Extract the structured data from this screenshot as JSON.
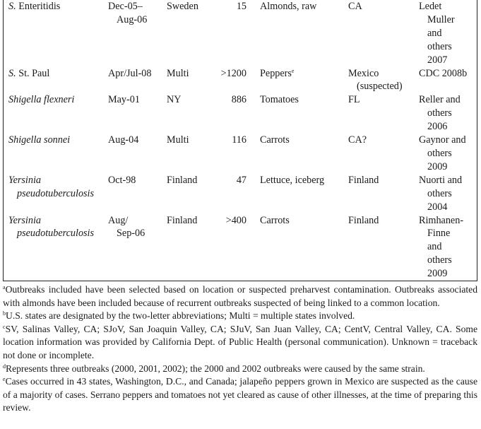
{
  "table": {
    "rows": [
      {
        "species_italic": "S.",
        "species_roman": " Enteritidis",
        "dates": "Dec-05–\nAug-06",
        "country": "Sweden",
        "cases": "15",
        "vehicle": "Almonds, raw",
        "vehicle_sup": "",
        "origin": "CA",
        "reference": "Ledet\nMuller\nand\nothers\n2007"
      },
      {
        "species_italic": "S.",
        "species_roman": " St. Paul",
        "dates": "Apr/Jul-08",
        "country": "Multi",
        "cases": ">1200",
        "vehicle": "Peppers",
        "vehicle_sup": "e",
        "origin": "Mexico\n(suspected)",
        "reference": "CDC 2008b"
      },
      {
        "species_italic": "Shigella flexneri",
        "species_roman": "",
        "dates": "May-01",
        "country": "NY",
        "cases": "886",
        "vehicle": "Tomatoes",
        "vehicle_sup": "",
        "origin": "FL",
        "reference": "Reller and\nothers\n2006"
      },
      {
        "species_italic": "Shigella sonnei",
        "species_roman": "",
        "dates": "Aug-04",
        "country": "Multi",
        "cases": "116",
        "vehicle": "Carrots",
        "vehicle_sup": "",
        "origin": "CA?",
        "reference": "Gaynor and\nothers\n2009"
      },
      {
        "species_italic": "Yersinia\npseudotuberculosis",
        "species_roman": "",
        "dates": "Oct-98",
        "country": "Finland",
        "cases": "47",
        "vehicle": "Lettuce, iceberg",
        "vehicle_sup": "",
        "origin": "Finland",
        "reference": "Nuorti and\nothers\n2004"
      },
      {
        "species_italic": "Yersinia\npseudotuberculosis",
        "species_roman": "",
        "dates": "Aug/\nSep-06",
        "country": "Finland",
        "cases": ">400",
        "vehicle": "Carrots",
        "vehicle_sup": "",
        "origin": "Finland",
        "reference": "Rimhanen-\nFinne\nand\nothers\n2009"
      }
    ]
  },
  "footnotes": [
    {
      "mark": "a",
      "text": "Outbreaks included have been selected based on location or suspected preharvest contamination. Outbreaks associated with almonds have been included because of recurrent outbreaks suspected of being linked to a common location."
    },
    {
      "mark": "b",
      "text": "U.S. states are designated by the two-letter abbreviations; Multi = multiple states involved."
    },
    {
      "mark": "c",
      "text": "SV, Salinas Valley, CA; SJoV, San Joaquin Valley, CA; SJuV, San Juan Valley, CA; CentV, Central Valley, CA. Some location information was provided by California Dept. of Public Health (personal communication). Unknown = traceback not done or incomplete."
    },
    {
      "mark": "d",
      "text": "Represents three outbreaks (2000, 2001, 2002); the 2000 and 2002 outbreaks were caused by the same strain."
    },
    {
      "mark": "e",
      "text": "Cases occurred in 43 states, Washington, D.C., and Canada; jalapeño peppers grown in Mexico are suspected as the cause of a majority of cases. Serrano peppers and tomatoes not yet cleared as cause of other illnesses, at the time of preparing this review."
    }
  ]
}
